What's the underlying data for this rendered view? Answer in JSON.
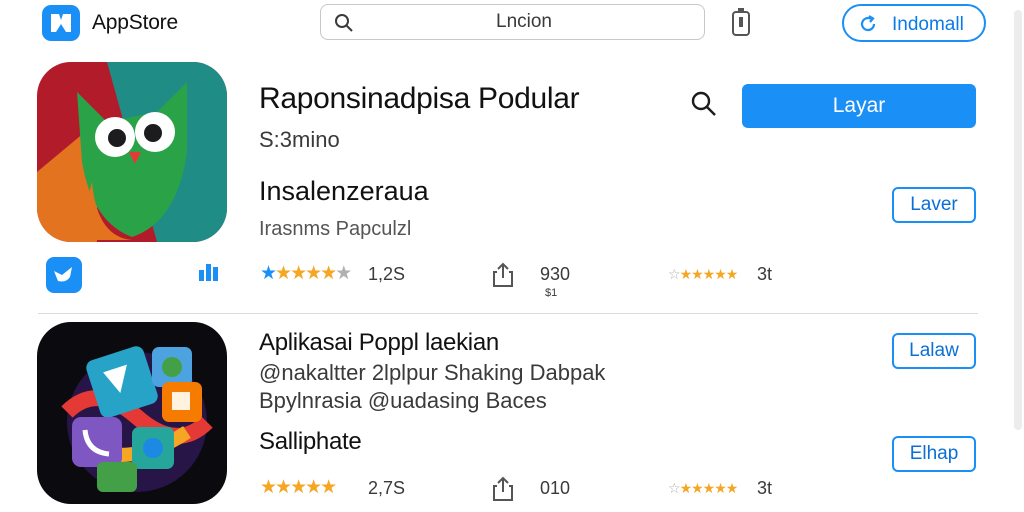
{
  "header": {
    "brand": "AppStore",
    "search_placeholder": "Lncion",
    "install_all_label": "Indomall"
  },
  "apps": [
    {
      "title": "Raponsinadpisa Podular",
      "subtitle": "S:3mino",
      "secondary_title": "Insalenzeraua",
      "category": "Irasnms Papculzl",
      "primary_button": "Layar",
      "outline_button": "Laver",
      "rating_stars": 5,
      "rating_count": "1,2S",
      "downloads": "930",
      "downloads_sub": "$1",
      "review_rating": "3t"
    },
    {
      "title": "Aplikasai Poppl laekian",
      "line2": "@nakaltter 2lplpur Shaking Dabpak",
      "line3": "Bpylnrasia @uadasing Baces",
      "secondary_title": "Salliphate",
      "outline_button_top": "Lalaw",
      "outline_button_bottom": "Elhap",
      "rating_stars": 5,
      "rating_count": "2,7S",
      "downloads": "010",
      "review_rating": "3t"
    }
  ],
  "colors": {
    "accent": "#1a8ff5",
    "star": "#f5a623"
  }
}
